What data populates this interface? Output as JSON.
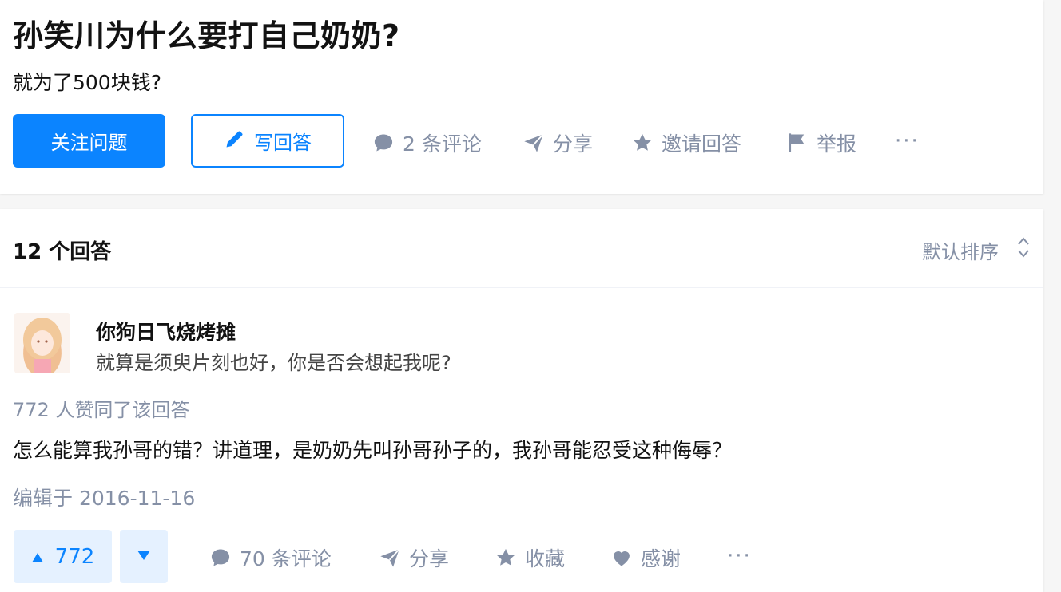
{
  "question": {
    "title": "孙笑川为什么要打自己奶奶?",
    "detail": "就为了500块钱?",
    "follow_label": "关注问题",
    "write_answer_label": "写回答",
    "actions": {
      "comments": "2 条评论",
      "share": "分享",
      "invite": "邀请回答",
      "report": "举报",
      "more": "···"
    }
  },
  "answers_header": {
    "count_label": "12 个回答",
    "sort_label": "默认排序"
  },
  "answer": {
    "author": {
      "name": "你狗日飞烧烤摊",
      "bio": "就算是须臾片刻也好，你是否会想起我呢?"
    },
    "votes_summary": "772 人赞同了该回答",
    "content": "怎么能算我孙哥的错？讲道理，是奶奶先叫孙哥孙子的，我孙哥能忍受这种侮辱？",
    "edited": "编辑于 2016-11-16",
    "upvote_count": "772",
    "actions": {
      "comments": "70 条评论",
      "share": "分享",
      "collect": "收藏",
      "thanks": "感谢",
      "more": "···"
    }
  },
  "colors": {
    "brand_blue": "#0b84ff",
    "meta_gray": "#8590a6",
    "vote_bg": "#e5f1ff"
  }
}
